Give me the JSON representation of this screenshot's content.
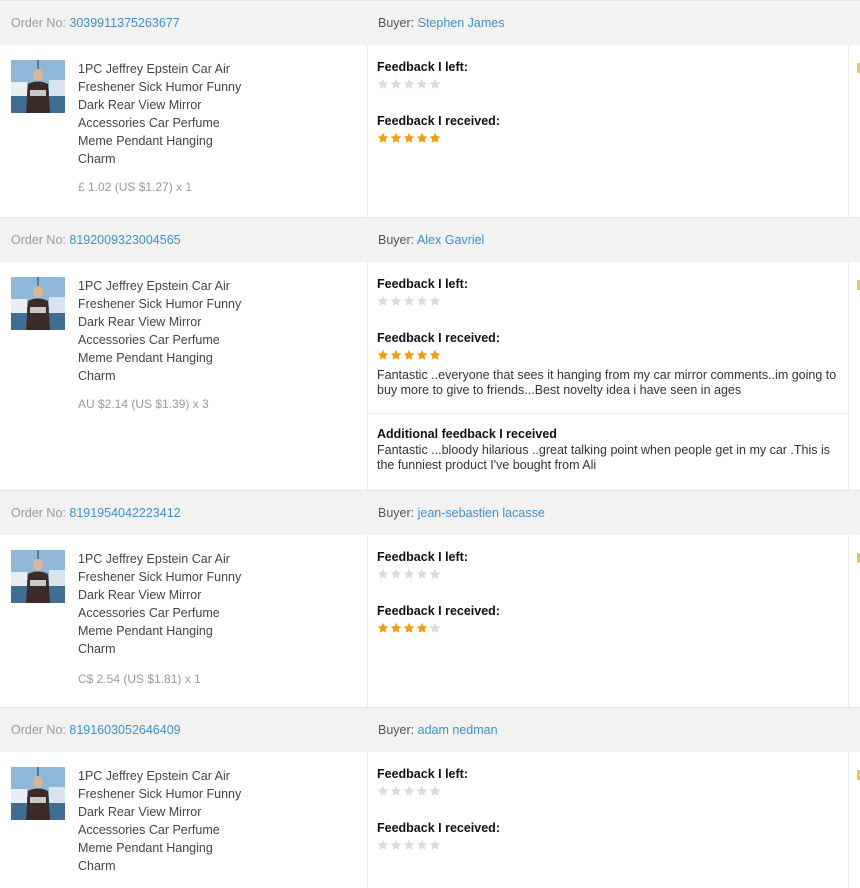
{
  "labels": {
    "order_no": "Order No:",
    "buyer": "Buyer:",
    "feedback_left": "Feedback I left:",
    "feedback_received": "Feedback I received:",
    "additional_feedback": "Additional feedback I received"
  },
  "colors": {
    "link": "#3d91c9",
    "star_filled": "#f59c12",
    "star_empty": "#dcdcdc",
    "header_bg": "#f2f2f2"
  },
  "orders": [
    {
      "order_no": "3039911375263677",
      "buyer": "Stephen James",
      "product_title": "1PC Jeffrey Epstein Car Air Freshener Sick Humor Funny Dark Rear View Mirror Accessories Car Perfume Meme Pendant Hanging Charm",
      "price": "£ 1.02 (US $1.27) x 1",
      "feedback_left_stars": 0,
      "feedback_received_stars": 5,
      "feedback_received_text": "",
      "additional_feedback": ""
    },
    {
      "order_no": "8192009323004565",
      "buyer": "Alex Gavriel",
      "product_title": "1PC Jeffrey Epstein Car Air Freshener Sick Humor Funny Dark Rear View Mirror Accessories Car Perfume Meme Pendant Hanging Charm",
      "price": "AU $2.14 (US $1.39) x 3",
      "feedback_left_stars": 0,
      "feedback_received_stars": 5,
      "feedback_received_text": "Fantastic ..everyone that sees it hanging from my car mirror comments..im going to buy more to give to friends...Best novelty idea i have seen in ages",
      "additional_feedback": "Fantastic ...bloody hilarious ..great talking point when people get in my car .This is the funniest product I've bought from Ali"
    },
    {
      "order_no": "8191954042223412",
      "buyer": "jean-sebastien lacasse",
      "product_title": "1PC Jeffrey Epstein Car Air Freshener Sick Humor Funny Dark Rear View Mirror Accessories Car Perfume Meme Pendant Hanging Charm",
      "price": "C$ 2.54 (US $1.81) x 1",
      "feedback_left_stars": 0,
      "feedback_received_stars": 4,
      "feedback_received_text": "",
      "additional_feedback": ""
    },
    {
      "order_no": "8191603052646409",
      "buyer": "adam nedman",
      "product_title": "1PC Jeffrey Epstein Car Air Freshener Sick Humor Funny Dark Rear View Mirror Accessories Car Perfume Meme Pendant Hanging Charm",
      "price": "",
      "feedback_left_stars": 0,
      "feedback_received_stars": 0,
      "feedback_received_text": "",
      "additional_feedback": ""
    }
  ]
}
